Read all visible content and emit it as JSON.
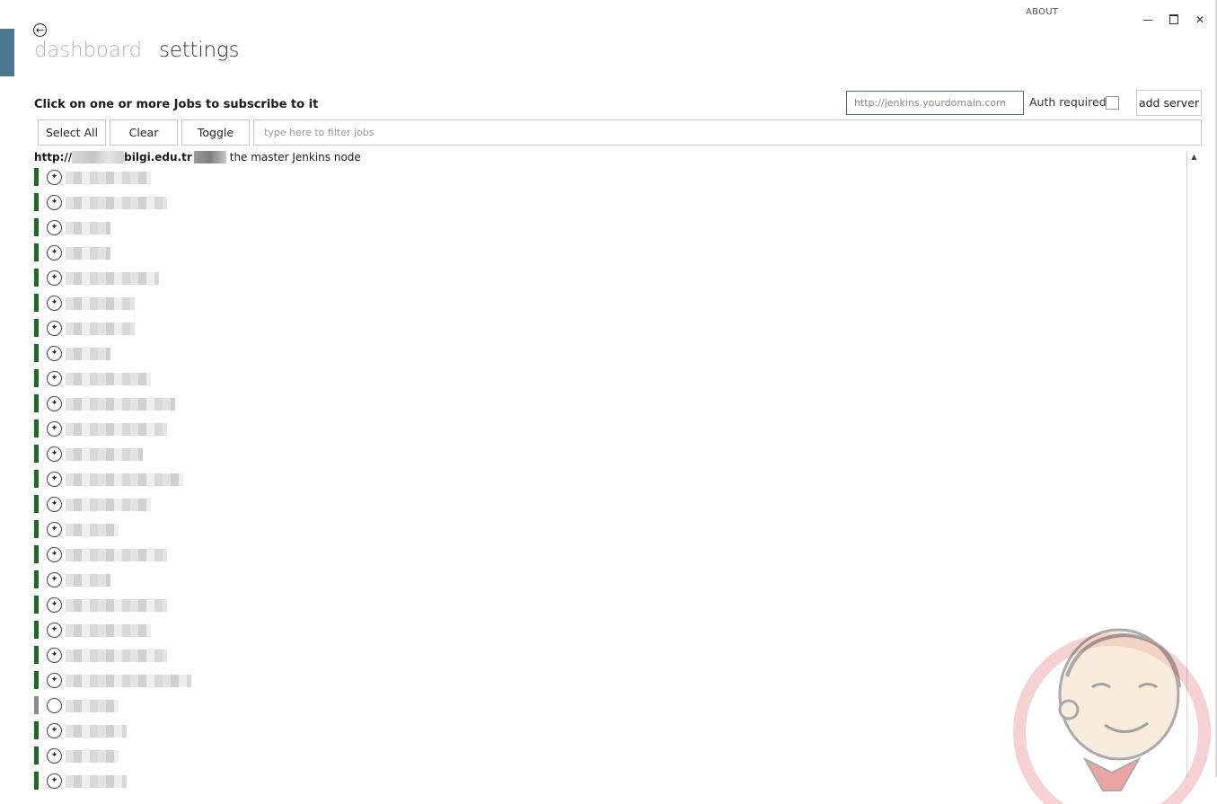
{
  "window": {
    "about_label": "ABOUT",
    "minimize_icon": "minimize-icon",
    "maximize_icon": "maximize-icon",
    "close_icon": "close-icon"
  },
  "header": {
    "back_icon": "arrow-left-circle-icon",
    "nav": {
      "dashboard": "dashboard",
      "settings": "settings"
    }
  },
  "toolbar": {
    "instructions": "Click on one or more Jobs to subscribe to it",
    "server_placeholder": "http://jenkins.yourdomain.com",
    "auth_label": "Auth required",
    "auth_checked": false,
    "add_server_label": "add server",
    "select_all_label": "Select All",
    "clear_label": "Clear",
    "toggle_label": "Toggle",
    "filter_placeholder": "type here to filter jobs"
  },
  "server": {
    "url_prefix": "http://",
    "url_domain": "bilgi.edu.tr",
    "description": "the master Jenkins node"
  },
  "colors": {
    "accent": "#4a7890",
    "status_success": "#1c6b25",
    "status_disabled": "#8a8a8a"
  },
  "jobs": [
    {
      "status": "success"
    },
    {
      "status": "success"
    },
    {
      "status": "success"
    },
    {
      "status": "success"
    },
    {
      "status": "success"
    },
    {
      "status": "success"
    },
    {
      "status": "success"
    },
    {
      "status": "success"
    },
    {
      "status": "success"
    },
    {
      "status": "success"
    },
    {
      "status": "success"
    },
    {
      "status": "success"
    },
    {
      "status": "success"
    },
    {
      "status": "success"
    },
    {
      "status": "success"
    },
    {
      "status": "success"
    },
    {
      "status": "success"
    },
    {
      "status": "success"
    },
    {
      "status": "success"
    },
    {
      "status": "success"
    },
    {
      "status": "success"
    },
    {
      "status": "disabled"
    },
    {
      "status": "success"
    },
    {
      "status": "success"
    },
    {
      "status": "success"
    }
  ]
}
